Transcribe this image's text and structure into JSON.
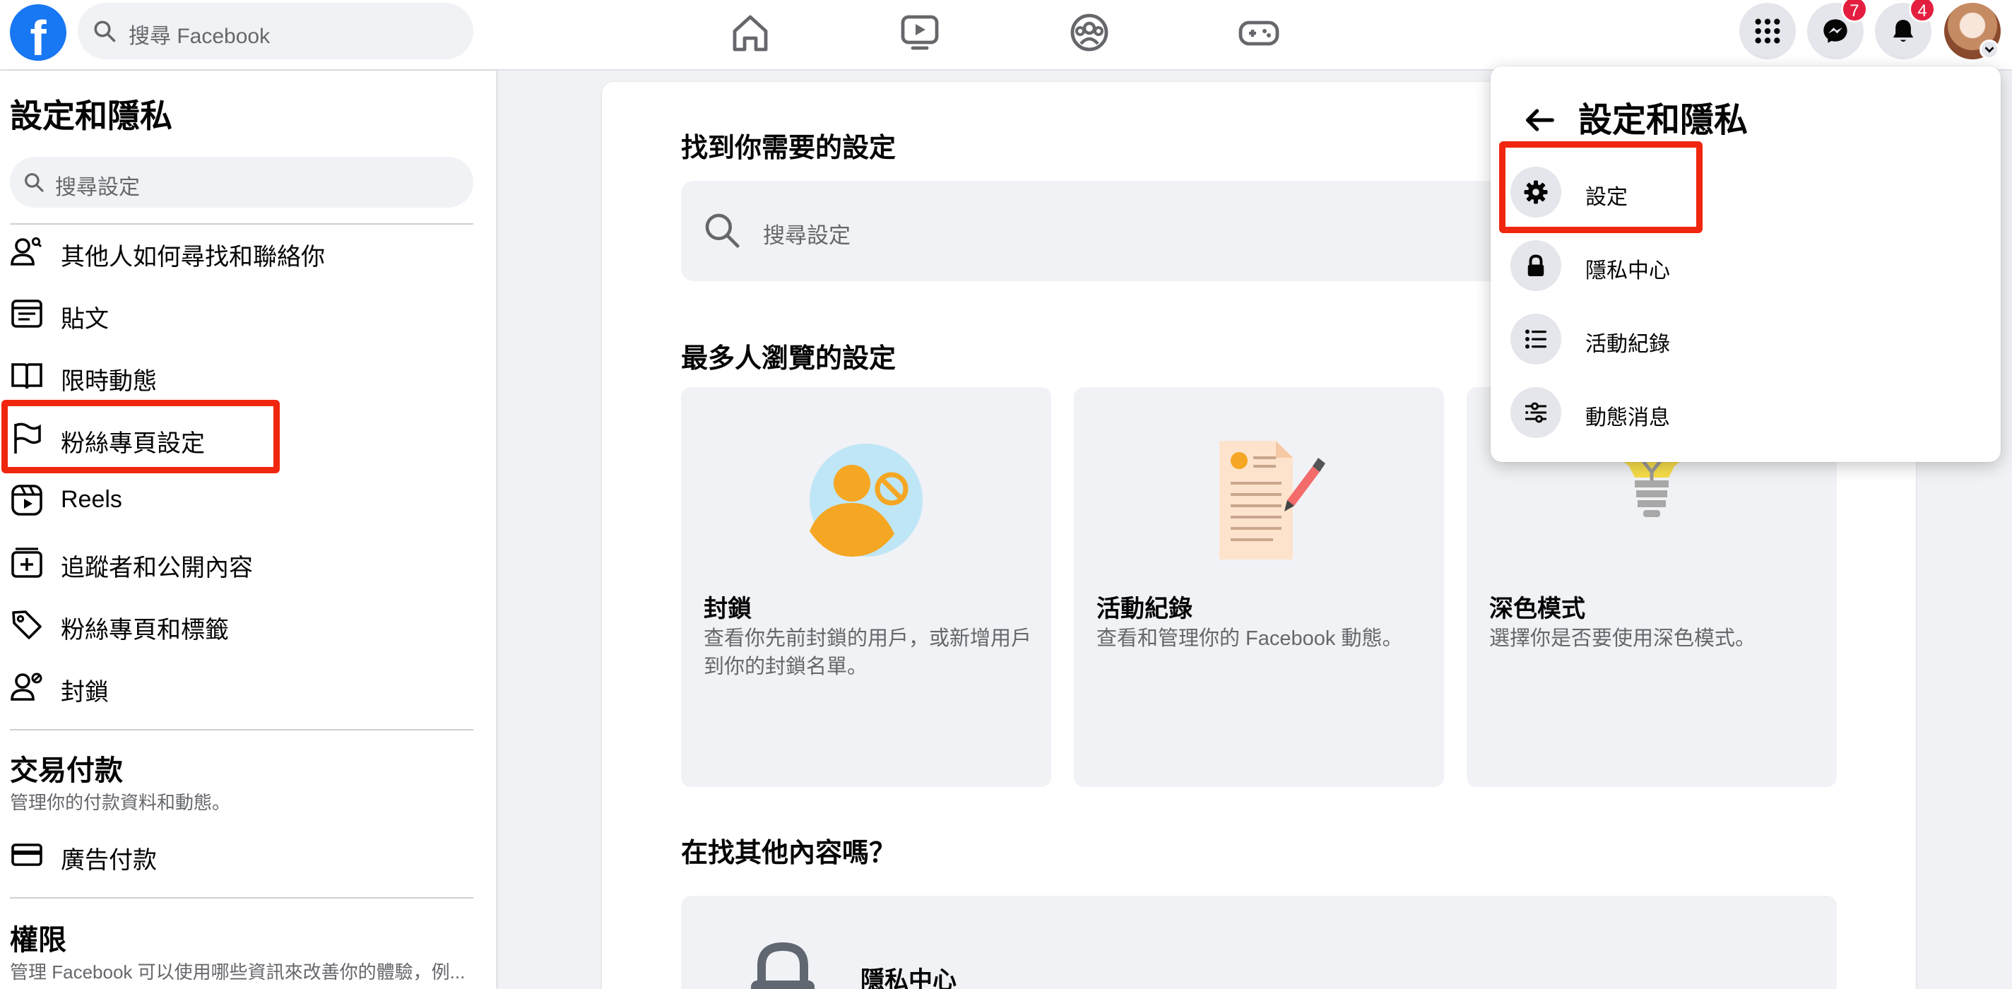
{
  "topbar": {
    "logo_letter": "f",
    "search_placeholder": "搜尋 Facebook",
    "nav_icons": [
      "home-icon",
      "watch-icon",
      "groups-icon",
      "gaming-icon"
    ],
    "messenger_badge": "7",
    "notifications_badge": "4"
  },
  "sidebar": {
    "title": "設定和隱私",
    "search_placeholder": "搜尋設定",
    "items": [
      {
        "label": "其他人如何尋找和聯絡你",
        "icon": "person-search-icon"
      },
      {
        "label": "貼文",
        "icon": "post-icon"
      },
      {
        "label": "限時動態",
        "icon": "book-icon"
      },
      {
        "label": "粉絲專頁設定",
        "icon": "flag-icon"
      },
      {
        "label": "Reels",
        "icon": "reels-icon"
      },
      {
        "label": "追蹤者和公開內容",
        "icon": "followers-icon"
      },
      {
        "label": "粉絲專頁和標籤",
        "icon": "tag-icon"
      },
      {
        "label": "封鎖",
        "icon": "block-person-icon"
      }
    ],
    "payments": {
      "title": "交易付款",
      "subtitle": "管理你的付款資料和動態。",
      "item_label": "廣告付款"
    },
    "permissions": {
      "title": "權限",
      "subtitle": "管理 Facebook 可以使用哪些資訊來改善你的體驗，例..."
    }
  },
  "main": {
    "find_heading": "找到你需要的設定",
    "search_placeholder": "搜尋設定",
    "popular_heading": "最多人瀏覽的設定",
    "tiles": [
      {
        "title": "封鎖",
        "desc": "查看你先前封鎖的用戶，或新增用戶到你的封鎖名單。"
      },
      {
        "title": "活動紀錄",
        "desc": "查看和管理你的 Facebook 動態。"
      },
      {
        "title": "深色模式",
        "desc": "選擇你是否要使用深色模式。"
      }
    ],
    "other_heading": "在找其他內容嗎？",
    "privacy_center_label": "隱私中心"
  },
  "dropdown": {
    "title": "設定和隱私",
    "items": [
      {
        "label": "設定",
        "icon": "gear-icon"
      },
      {
        "label": "隱私中心",
        "icon": "lock-icon"
      },
      {
        "label": "活動紀錄",
        "icon": "list-icon"
      },
      {
        "label": "動態消息",
        "icon": "sliders-icon"
      }
    ]
  },
  "colors": {
    "brand": "#1877f2",
    "highlight": "#f0260f",
    "badge": "#e41e3f"
  }
}
